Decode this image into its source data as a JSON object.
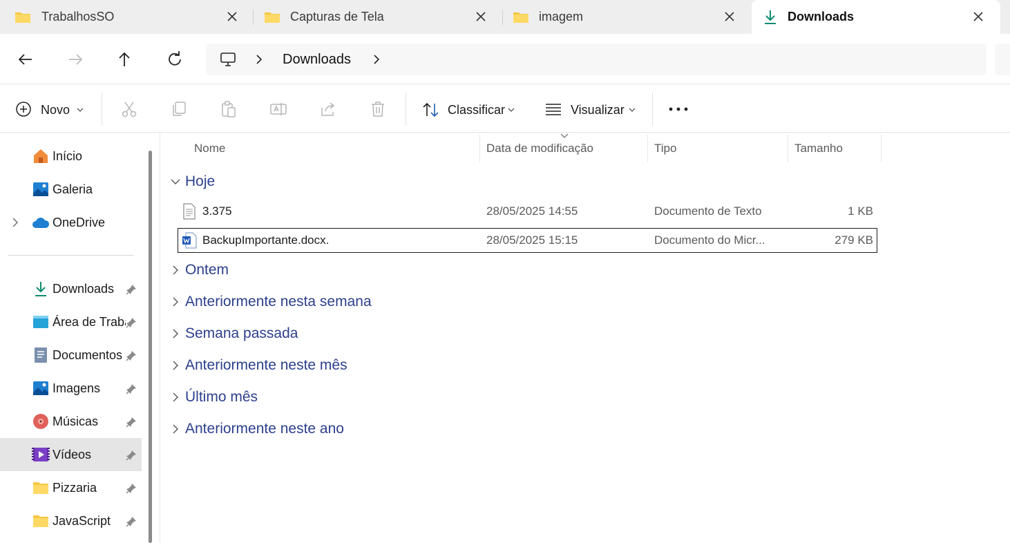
{
  "tabs": [
    {
      "label": "TrabalhosSO",
      "icon": "folder-icon",
      "active": false
    },
    {
      "label": "Capturas de Tela",
      "icon": "folder-icon",
      "active": false
    },
    {
      "label": "imagem",
      "icon": "folder-icon",
      "active": false
    },
    {
      "label": "Downloads",
      "icon": "download-icon",
      "active": true
    }
  ],
  "address": {
    "root_icon": "this-pc-icon",
    "segments": [
      "Downloads"
    ]
  },
  "toolbar": {
    "new_label": "Novo",
    "sort_label": "Classificar",
    "view_label": "Visualizar",
    "icons": [
      "cut-icon",
      "copy-icon",
      "paste-icon",
      "rename-icon",
      "share-icon",
      "delete-icon"
    ]
  },
  "sidebar": {
    "top": [
      {
        "label": "Início",
        "icon": "home-icon",
        "expandable": false
      },
      {
        "label": "Galeria",
        "icon": "gallery-icon",
        "expandable": false
      },
      {
        "label": "OneDrive",
        "icon": "cloud-icon",
        "expandable": true
      }
    ],
    "pinned": [
      {
        "label": "Downloads",
        "icon": "download-icon"
      },
      {
        "label": "Área de Trabalho",
        "icon": "desktop-icon"
      },
      {
        "label": "Documentos",
        "icon": "documents-icon"
      },
      {
        "label": "Imagens",
        "icon": "pictures-icon"
      },
      {
        "label": "Músicas",
        "icon": "music-icon"
      },
      {
        "label": "Vídeos",
        "icon": "videos-icon",
        "selected": true
      },
      {
        "label": "Pizzaria",
        "icon": "folder-icon"
      },
      {
        "label": "JavaScript",
        "icon": "folder-icon"
      }
    ]
  },
  "columns": {
    "name": "Nome",
    "date": "Data de modificação",
    "type": "Tipo",
    "size": "Tamanho"
  },
  "groups": {
    "expanded": {
      "label": "Hoje",
      "files": [
        {
          "name": "3.375",
          "date": "28/05/2025 14:55",
          "type": "Documento de Texto",
          "size": "1 KB",
          "icon": "text-file-icon"
        },
        {
          "name": "BackupImportante.docx.",
          "date": "28/05/2025 15:15",
          "type": "Documento do Micr...",
          "size": "279 KB",
          "icon": "word-file-icon"
        }
      ]
    },
    "collapsed": [
      "Ontem",
      "Anteriormente nesta semana",
      "Semana passada",
      "Anteriormente neste mês",
      "Último mês",
      "Anteriormente neste ano"
    ]
  },
  "colors": {
    "accent_green": "#0f8a6e",
    "group_blue": "#2b3f8c",
    "folder_yellow": "#f6c744",
    "selection_bg": "#e5e5e5"
  }
}
